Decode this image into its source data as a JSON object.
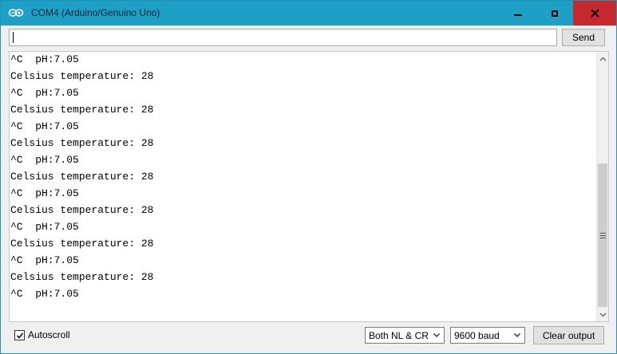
{
  "window": {
    "title": "COM4 (Arduino/Genuino Uno)",
    "colors": {
      "titlebar": "#1ea0c6",
      "close": "#c7282e"
    }
  },
  "icons": {
    "app": "arduino-infinity-icon",
    "minimize": "minimize-icon",
    "maximize": "maximize-icon",
    "close": "close-icon",
    "check": "checkmark-icon",
    "dropdown": "chevron-down-icon",
    "grip": "scroll-grip-icon"
  },
  "input": {
    "value": "",
    "placeholder": ""
  },
  "send_label": "Send",
  "output": {
    "lines": [
      "^C  pH:7.05",
      "Celsius temperature: 28",
      "^C  pH:7.05",
      "Celsius temperature: 28",
      "^C  pH:7.05",
      "Celsius temperature: 28",
      "^C  pH:7.05",
      "Celsius temperature: 28",
      "^C  pH:7.05",
      "Celsius temperature: 28",
      "^C  pH:7.05",
      "Celsius temperature: 28",
      "^C  pH:7.05",
      "Celsius temperature: 28",
      "^C  pH:7.05"
    ]
  },
  "footer": {
    "autoscroll_label": "Autoscroll",
    "autoscroll_checked": true,
    "line_ending": "Both NL & CR",
    "baud": "9600 baud",
    "clear_label": "Clear output"
  }
}
